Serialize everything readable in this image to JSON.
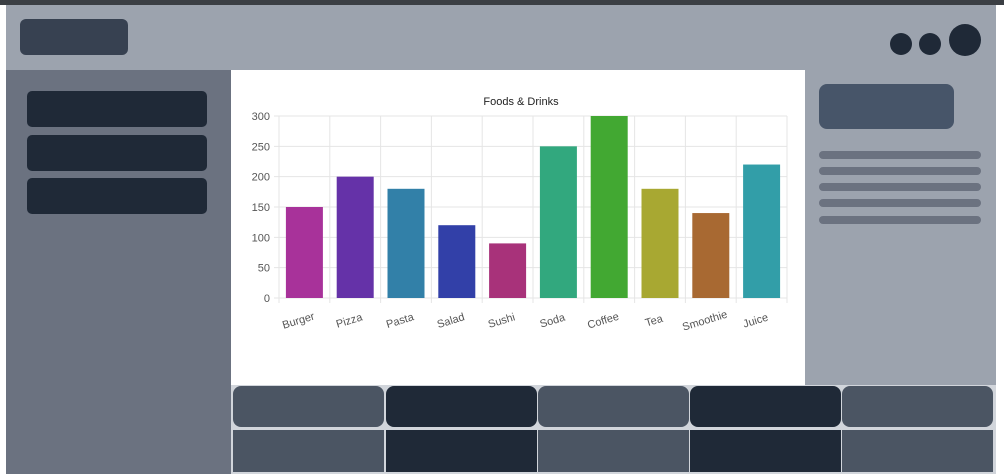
{
  "chart_data": {
    "type": "bar",
    "title": "Foods & Drinks",
    "categories": [
      "Burger",
      "Pizza",
      "Pasta",
      "Salad",
      "Sushi",
      "Soda",
      "Coffee",
      "Tea",
      "Smoothie",
      "Juice"
    ],
    "values": [
      150,
      200,
      180,
      120,
      90,
      250,
      300,
      180,
      140,
      220
    ],
    "colors": [
      "#a8329a",
      "#6532a8",
      "#3280a8",
      "#3240a8",
      "#a8327a",
      "#32a87e",
      "#42a832",
      "#a8a832",
      "#a86932",
      "#329ea8"
    ],
    "ylim": [
      0,
      300
    ],
    "yticks": [
      "0",
      "50",
      "100",
      "150",
      "200",
      "250",
      "300"
    ],
    "ytick_values": [
      0,
      50,
      100,
      150,
      200,
      250,
      300
    ],
    "grid": true,
    "legend": "none"
  }
}
